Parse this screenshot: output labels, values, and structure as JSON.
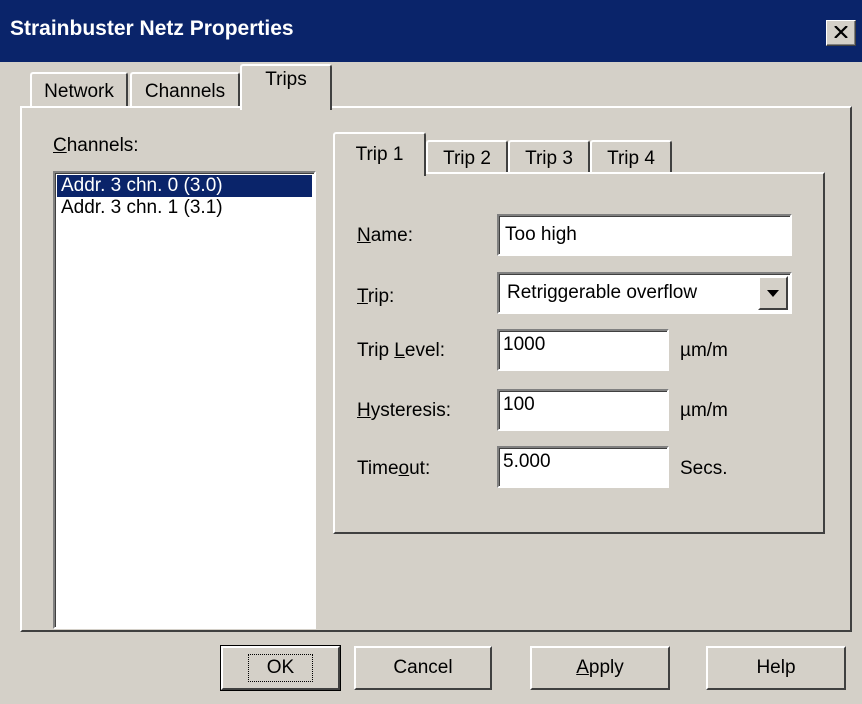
{
  "window": {
    "title": "Strainbuster Netz Properties",
    "close_glyph": "✕"
  },
  "outer_tabs": [
    {
      "label": "Network",
      "active": false
    },
    {
      "label": "Channels",
      "active": false
    },
    {
      "label": "Trips",
      "active": true
    }
  ],
  "channels": {
    "label_mnemonic": "C",
    "label_rest": "hannels:",
    "items": [
      {
        "label": "Addr. 3 chn. 0 (3.0)",
        "selected": true
      },
      {
        "label": "Addr. 3 chn. 1 (3.1)",
        "selected": false
      }
    ]
  },
  "inner_tabs": [
    {
      "label": "Trip 1",
      "active": true
    },
    {
      "label": "Trip 2",
      "active": false
    },
    {
      "label": "Trip 3",
      "active": false
    },
    {
      "label": "Trip 4",
      "active": false
    }
  ],
  "form": {
    "name": {
      "label_mnemonic": "N",
      "label_rest": "ame:",
      "value": "Too high"
    },
    "trip": {
      "label_mnemonic": "T",
      "label_rest": "rip:",
      "value": "Retriggerable overflow"
    },
    "trip_level": {
      "label_pre": "Trip ",
      "label_mnemonic": "L",
      "label_rest": "evel:",
      "value": "1000",
      "unit": "µm/m"
    },
    "hysteresis": {
      "label_mnemonic": "H",
      "label_rest": "ysteresis:",
      "value": "100",
      "unit": "µm/m"
    },
    "timeout": {
      "label_pre": "Time",
      "label_mnemonic": "o",
      "label_rest": "ut:",
      "value": "5.000",
      "unit": "Secs."
    }
  },
  "buttons": {
    "ok": "OK",
    "cancel": "Cancel",
    "apply_mnemonic": "A",
    "apply_rest": "pply",
    "help": "Help"
  },
  "colors": {
    "titlebar": "#0a246a",
    "face": "#d4d0c8",
    "selection": "#0a246a"
  }
}
